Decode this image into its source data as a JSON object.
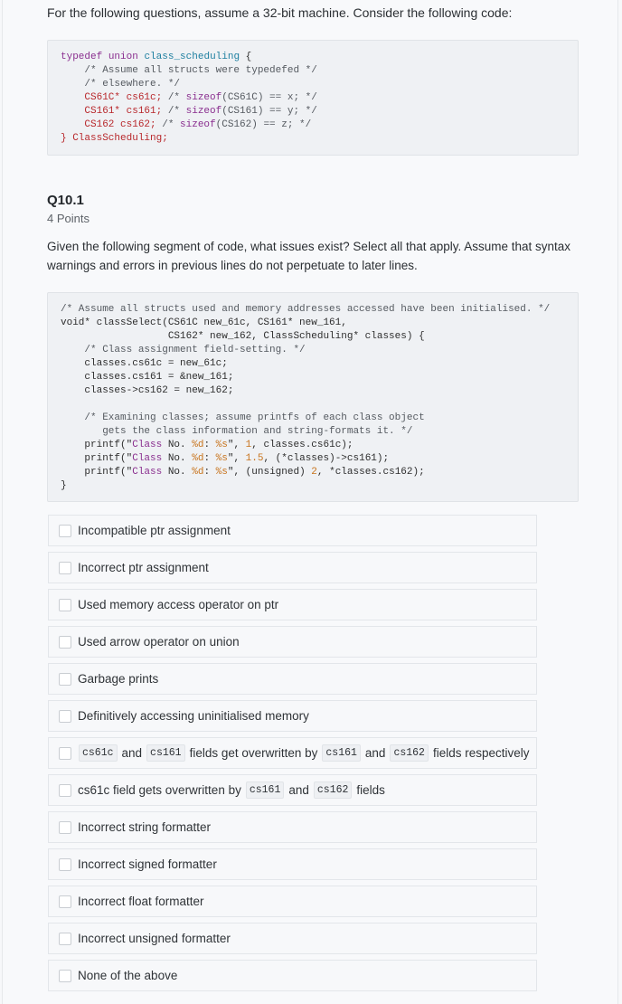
{
  "intro": "For the following questions, assume a 32-bit machine. Consider the following code:",
  "code1": {
    "line1": {
      "kw1": "typedef",
      "kw2": "union",
      "type": "class_scheduling",
      "rest": " {"
    },
    "line2": "    /* Assume all structs were typedefed */",
    "line3": "    /* elsewhere. */",
    "line4": {
      "decl": "    CS61C* cs61c;",
      "c1": " /* ",
      "fn": "sizeof",
      "c2": "(CS61C) == x; */"
    },
    "line5": {
      "decl": "    CS161* cs161;",
      "c1": " /* ",
      "fn": "sizeof",
      "c2": "(CS161) == y; */"
    },
    "line6": {
      "decl": "    CS162 cs162;",
      "c1": " /* ",
      "fn": "sizeof",
      "c2": "(CS162) == z; */"
    },
    "line7": "} ClassScheduling;"
  },
  "question": {
    "title": "Q10.1",
    "points": "4 Points",
    "text": "Given the following segment of code, what issues exist? Select all that apply. Assume that syntax warnings and errors in previous lines do not perpetuate to later lines."
  },
  "code2": {
    "l1": "/* Assume all structs used and memory addresses accessed have been initialised. */",
    "l2": "void* classSelect(CS61C new_61c, CS161* new_161,",
    "l3": "                  CS162* new_162, ClassScheduling* classes) {",
    "l4": "    /* Class assignment field-setting. */",
    "l5": "    classes.cs61c = new_61c;",
    "l6": "    classes.cs161 = &new_161;",
    "l7": "    classes->cs162 = new_162;",
    "l8": "",
    "l9": "    /* Examining classes; assume printfs of each class object",
    "l10": "       gets the class information and string-formats it. */",
    "p1": {
      "a": "    printf(\"",
      "s": "Class",
      "b": " No. ",
      "f1": "%d",
      "c": ": ",
      "f2": "%s",
      "d": "\", ",
      "num": "1",
      "e": ", classes.cs61c);"
    },
    "p2": {
      "a": "    printf(\"",
      "s": "Class",
      "b": " No. ",
      "f1": "%d",
      "c": ": ",
      "f2": "%s",
      "d": "\", ",
      "num": "1.5",
      "e": ", (*classes)->cs161);"
    },
    "p3": {
      "a": "    printf(\"",
      "s": "Class",
      "b": " No. ",
      "f1": "%d",
      "c": ": ",
      "f2": "%s",
      "d": "\", (unsigned) ",
      "num": "2",
      "e": ", *classes.cs162);"
    },
    "l14": "}"
  },
  "options": [
    {
      "label": "Incompatible ptr assignment",
      "checked": false
    },
    {
      "label": "Incorrect ptr assignment",
      "checked": false
    },
    {
      "label": "Used memory access operator on ptr",
      "checked": false
    },
    {
      "label": "Used arrow operator on union",
      "checked": false
    },
    {
      "label": "Garbage prints",
      "checked": false
    },
    {
      "label": "Definitively accessing uninitialised memory",
      "checked": false
    },
    {
      "parts": {
        "code1": "cs61c",
        "w1": "and",
        "code2": "cs161",
        "w2": "fields get overwritten by",
        "code3": "cs161",
        "w3": "and",
        "code4": "cs162",
        "w4": "fields respectively"
      },
      "checked": false
    },
    {
      "parts": {
        "pre": "cs61c field gets overwritten by",
        "code1": "cs161",
        "w1": "and",
        "code2": "cs162",
        "w2": "fields"
      },
      "checked": false
    },
    {
      "label": "Incorrect string formatter",
      "checked": false
    },
    {
      "label": "Incorrect signed formatter",
      "checked": false
    },
    {
      "label": "Incorrect float formatter",
      "checked": false
    },
    {
      "label": "Incorrect unsigned formatter",
      "checked": false
    },
    {
      "label": "None of the above",
      "checked": false
    }
  ]
}
